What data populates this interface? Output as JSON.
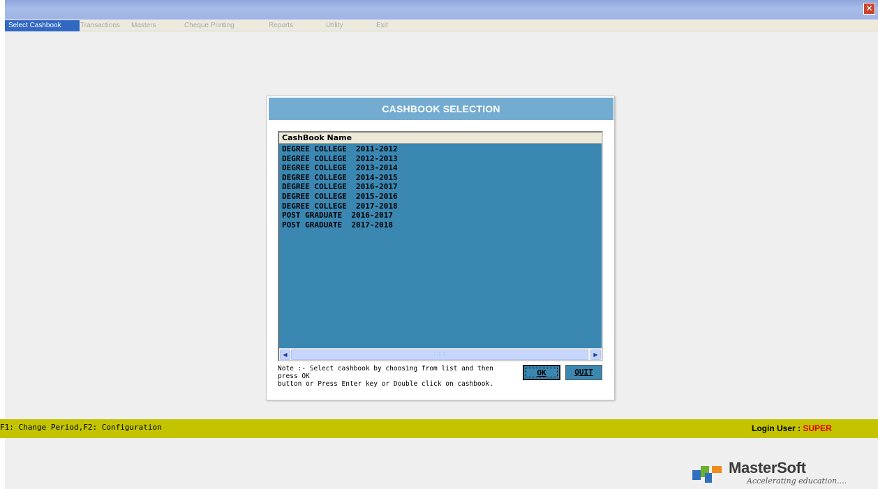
{
  "window": {
    "close_glyph": "✕"
  },
  "menu": {
    "items": [
      {
        "label": "Select Cashbook",
        "active": true
      },
      {
        "label": "Transactions",
        "active": false
      },
      {
        "label": "Masters",
        "active": false
      },
      {
        "label": "Cheque Printing",
        "active": false
      },
      {
        "label": "Reports",
        "active": false
      },
      {
        "label": "Utility",
        "active": false
      },
      {
        "label": "Exit",
        "active": false
      }
    ]
  },
  "dialog": {
    "title": "CASHBOOK SELECTION",
    "list_header": "CashBook Name",
    "cashbooks": [
      "DEGREE COLLEGE  2011-2012",
      "DEGREE COLLEGE  2012-2013",
      "DEGREE COLLEGE  2013-2014",
      "DEGREE COLLEGE  2014-2015",
      "DEGREE COLLEGE  2016-2017",
      "DEGREE COLLEGE  2015-2016",
      "DEGREE COLLEGE  2017-2018",
      "POST GRADUATE  2016-2017",
      "POST GRADUATE  2017-2018"
    ],
    "note_line1": "Note :- Select cashbook by choosing from list and then press OK",
    "note_line2": "button or Press Enter key or Double click on cashbook.",
    "ok_label": "OK",
    "quit_label": "QUIT"
  },
  "status": {
    "shortcuts": "F1: Change Period,F2: Configuration",
    "login_label": "Login User : ",
    "login_user": "SUPER"
  },
  "branding": {
    "name": "MasterSoft",
    "tagline": "Accelerating education....",
    "colors": {
      "blue": "#2f6fbf",
      "green": "#6fae2f",
      "orange": "#f08c1e"
    }
  },
  "colors": {
    "title_bar": "#73acd0",
    "list_bg": "#3a87b2",
    "status_bar": "#c3c300",
    "menu_active": "#3168c2"
  }
}
